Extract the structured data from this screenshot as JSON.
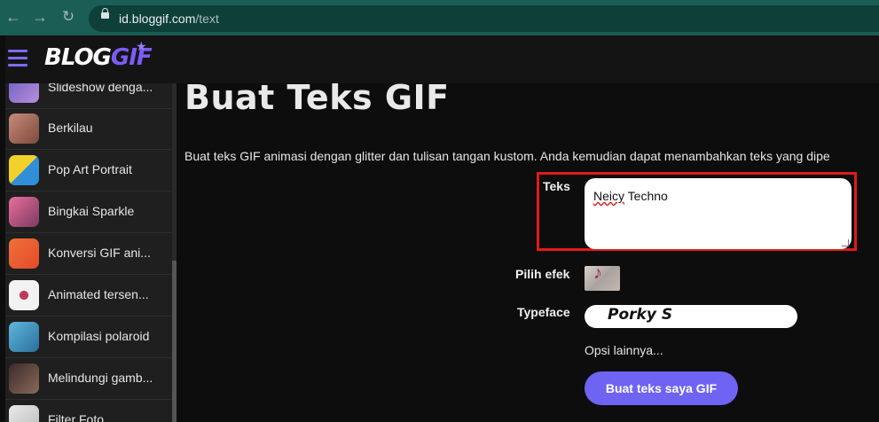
{
  "browser": {
    "domain": "id.bloggif.com",
    "path": "/text",
    "back_icon": "arrow-left",
    "forward_icon": "arrow-right",
    "reload_icon": "reload"
  },
  "header": {
    "logo_main": "BLOG",
    "logo_accent": "GIF",
    "accent_color": "#7b5cf6"
  },
  "sidebar": {
    "items": [
      {
        "label": "Slideshow denga...",
        "thumb_colors": [
          "#6a5cc4",
          "#b88fd9"
        ]
      },
      {
        "label": "Berkilau",
        "thumb_colors": [
          "#c98a7a",
          "#7b4b3c"
        ]
      },
      {
        "label": "Pop Art Portrait",
        "thumb_colors": [
          "#f4d02a",
          "#2f8fd8"
        ]
      },
      {
        "label": "Bingkai Sparkle",
        "thumb_colors": [
          "#e86f9b",
          "#7c3a62"
        ]
      },
      {
        "label": "Konversi GIF ani...",
        "thumb_colors": [
          "#f0703a",
          "#e44a2a"
        ]
      },
      {
        "label": "Animated tersen...",
        "thumb_colors": [
          "#f2f2f2",
          "#c23a5a"
        ]
      },
      {
        "label": "Kompilasi polaroid",
        "thumb_colors": [
          "#5fb6e0",
          "#2a6f9a"
        ]
      },
      {
        "label": "Melindungi gamb...",
        "thumb_colors": [
          "#3a2a2a",
          "#8a6a5a"
        ]
      },
      {
        "label": "Filter Foto",
        "thumb_colors": [
          "#e8e8e8",
          "#bdbdbd"
        ]
      }
    ]
  },
  "main": {
    "title": "Buat Teks GIF",
    "description": "Buat teks GIF animasi dengan glitter dan tulisan tangan kustom. Anda kemudian dapat menambahkan teks yang dipe",
    "form": {
      "text_label": "Teks",
      "text_value_first": "Neicy",
      "text_value_rest": " Techno",
      "effect_label": "Pilih efek",
      "typeface_label": "Typeface",
      "typeface_value": "Porky S",
      "more_options": "Opsi lainnya...",
      "submit_label": "Buat teks saya GIF"
    }
  }
}
